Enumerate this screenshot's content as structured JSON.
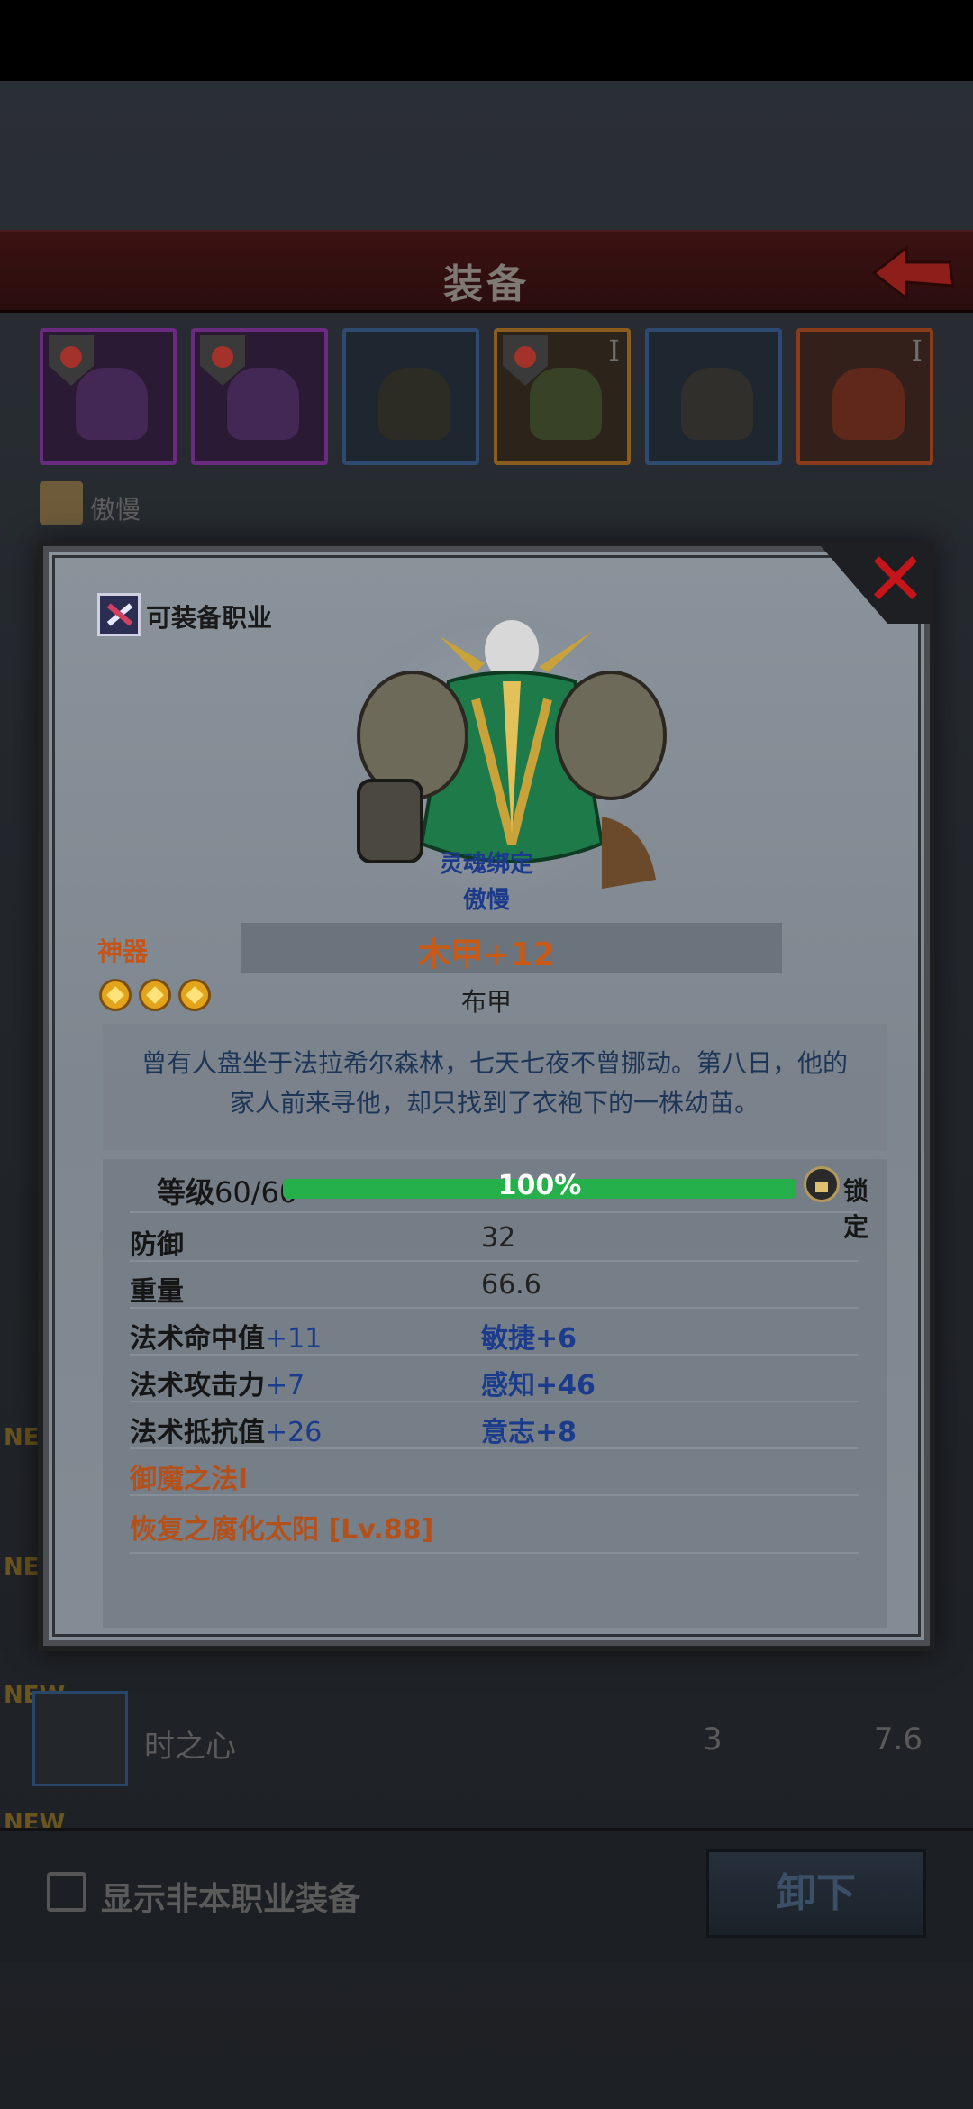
{
  "header": {
    "title": "装备"
  },
  "equipment_slots": [
    {
      "tier": ""
    },
    {
      "tier": ""
    },
    {
      "tier": ""
    },
    {
      "tier": "I"
    },
    {
      "tier": ""
    },
    {
      "tier": "I"
    }
  ],
  "owner": {
    "name": "傲慢"
  },
  "side_badges": [
    "NEW",
    "NEW",
    "NEW",
    "NEW"
  ],
  "list_item": {
    "name": "时之心",
    "count": "3",
    "weight": "7.6"
  },
  "bottom": {
    "checkbox_label": "显示非本职业装备",
    "unequip_label": "卸下"
  },
  "modal": {
    "class_label": "可装备职业",
    "soulbound": "灵魂绑定",
    "owner": "傲慢",
    "rarity": "神器",
    "item_name": "木甲+12",
    "stars": 3,
    "item_type": "布甲",
    "description": "曾有人盘坐于法拉希尔森林，七天七夜不曾挪动。第八日，他的家人前来寻他，却只找到了衣袍下的一株幼苗。",
    "level": {
      "label": "等级",
      "value": "60/60",
      "progress_text": "100%",
      "progress": 1.0,
      "lock_label": "锁定"
    },
    "stats": [
      {
        "label": "防御",
        "value": "32"
      },
      {
        "label": "重量",
        "value": "66.6"
      }
    ],
    "bonus_stats": [
      {
        "left": "法术命中值+11",
        "right": "敏捷+6"
      },
      {
        "left": "法术攻击力+7",
        "right": "感知+46"
      },
      {
        "left": "法术抵抗值+26",
        "right": "意志+8"
      }
    ],
    "skills": [
      "御魔之法Ⅰ",
      "恢复之腐化太阳 [Lv.88]"
    ]
  },
  "colors": {
    "accent_orange": "#c85a18",
    "link_blue": "#1c3a8c",
    "close_red": "#c4151a",
    "xp_green": "#26b04c"
  }
}
